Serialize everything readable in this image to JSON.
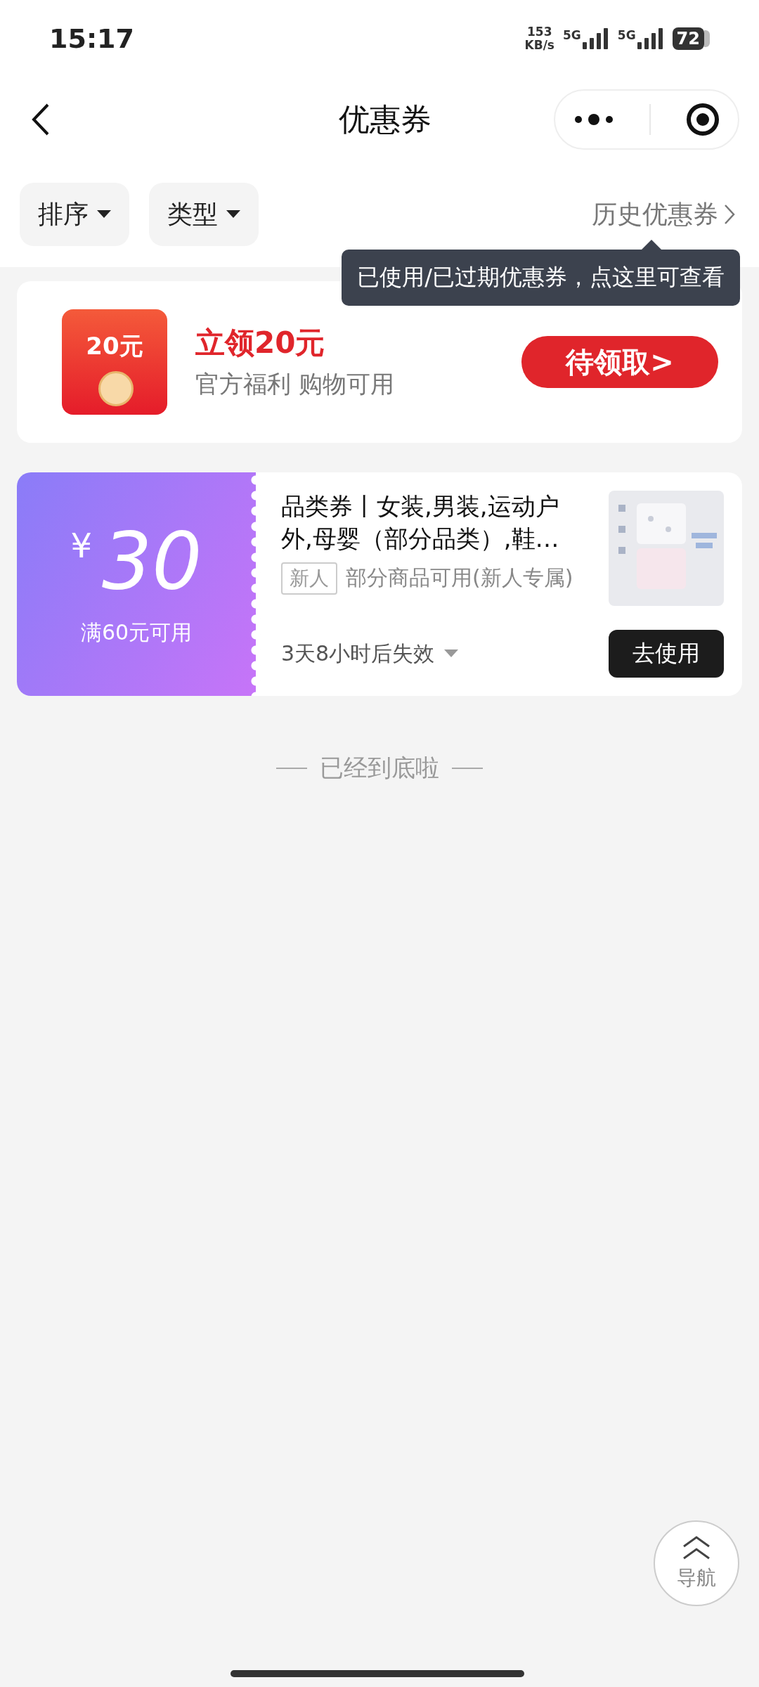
{
  "status_bar": {
    "time": "15:17",
    "net_speed": "153",
    "net_unit": "KB/s",
    "signals": [
      "5G",
      "5G"
    ],
    "battery": "72"
  },
  "header": {
    "title": "优惠券"
  },
  "filters": [
    {
      "label": "排序"
    },
    {
      "label": "类型"
    }
  ],
  "history_link": "历史优惠券",
  "tooltip": "已使用/已过期优惠券，点这里可查看",
  "promo": {
    "badge": "20元",
    "title": "立领20元",
    "subtitle": "官方福利 购物可用",
    "button": "待领取>"
  },
  "coupons": [
    {
      "currency": "¥",
      "amount": "30",
      "condition": "满60元可用",
      "title": "品类券丨女装,男装,运动户外,母婴（部分品类）,鞋…",
      "tag": "新人",
      "scope": "部分商品可用(新人专属)",
      "expiry": "3天8小时后失效",
      "button": "去使用"
    }
  ],
  "end_text": "已经到底啦",
  "nav_button": "导航"
}
